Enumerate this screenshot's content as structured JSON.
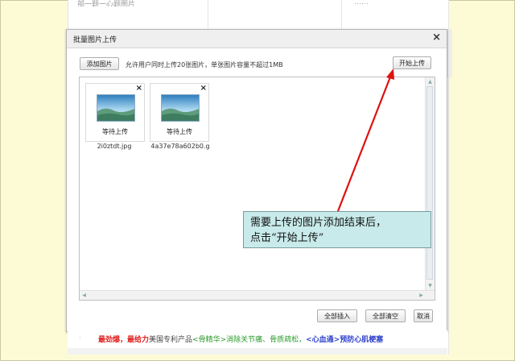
{
  "background_page": {
    "top_text": "部一题一心题图片",
    "right_text": "……"
  },
  "dialog": {
    "title": "批量图片上传",
    "close_glyph": "×",
    "add_button": "添加图片",
    "hint": "允许用户同时上传20张图片，单张图片容量不超过1MB",
    "start_button": "开始上传",
    "thumbnails": [
      {
        "remove": "×",
        "status": "等待上传",
        "filename": "2i0ztdt.jpg"
      },
      {
        "remove": "×",
        "status": "等待上传",
        "filename": "4a37e78a602b0.g"
      }
    ],
    "footer": {
      "insert_all": "全部插入",
      "clear_all": "全部清空",
      "cancel": "取消"
    }
  },
  "callout": {
    "line1": "需要上传的图片添加结束后，",
    "line2": "点击“开始上传”"
  },
  "promo": {
    "dot": "·",
    "seg1": "最劲爆，",
    "seg2": "最给力",
    "seg3": "美国专利产品",
    "seg4": "<骨精华>消除关节痛、骨质疏松，",
    "seg5": "<心血通>预防心肌梗塞"
  },
  "colors": {
    "slide_background": "#fdfbd6",
    "callout_fill": "#c8eaea",
    "arrow": "#e01010",
    "promo_red": "#e02020",
    "promo_green": "#2a9a2a",
    "promo_blue": "#3344cc"
  }
}
